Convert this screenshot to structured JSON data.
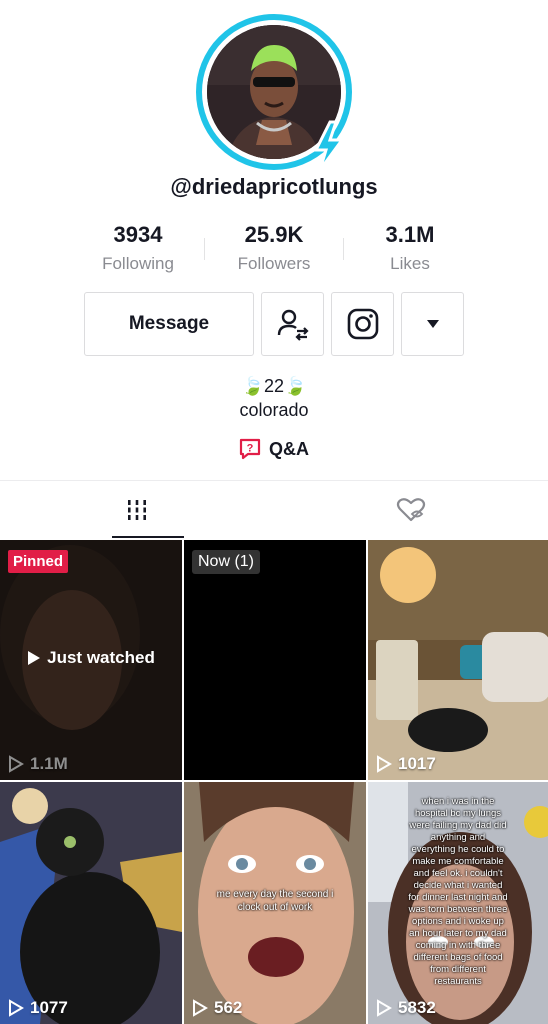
{
  "profile": {
    "username": "@driedapricotlungs",
    "stats": [
      {
        "value": "3934",
        "label": "Following"
      },
      {
        "value": "25.9K",
        "label": "Followers"
      },
      {
        "value": "3.1M",
        "label": "Likes"
      }
    ],
    "message_label": "Message",
    "bio_line1": "🍃22🍃",
    "bio_line2": "colorado",
    "qa_label": "Q&A"
  },
  "colors": {
    "ring": "#20c4e8",
    "pinned": "#e11e47",
    "qa_icon": "#e11e47"
  },
  "icons": {
    "follow_suggest": "person-swap-icon",
    "instagram": "instagram-icon",
    "more": "caret-down-icon",
    "videos_tab": "grid-bars-icon",
    "liked_tab": "heart-hidden-icon",
    "play": "play-icon"
  },
  "grid": {
    "pinned_label": "Pinned",
    "now_label": "Now (1)",
    "just_watched": "Just watched",
    "videos": [
      {
        "views": "1.1M"
      },
      {
        "views": ""
      },
      {
        "views": "1017"
      },
      {
        "views": "1077"
      },
      {
        "views": "562",
        "caption": "me every day the second i clock out of work"
      },
      {
        "views": "5832",
        "caption": "when i was in the hospital bc my lungs were failing my dad did anything and everything he could to make me comfortable and feel ok. i couldn't decide what i wanted for dinner last night and was torn between three options and i woke up an hour later to my dad coming in with three different bags of food from different restaurants"
      }
    ]
  }
}
